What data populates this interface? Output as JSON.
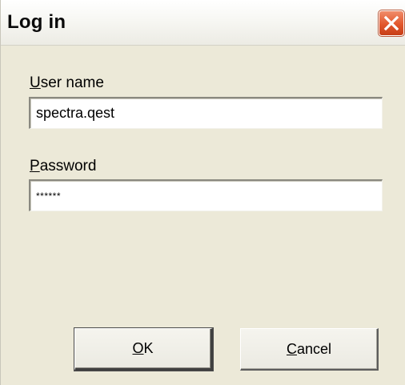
{
  "window": {
    "title": "Log in",
    "close_icon": "close-icon",
    "close_color": "#e2572c"
  },
  "form": {
    "username": {
      "label_accel": "U",
      "label_rest": "ser name",
      "value": "spectra.qest"
    },
    "password": {
      "label_accel": "P",
      "label_rest": "assword",
      "value": "******"
    }
  },
  "buttons": {
    "ok": {
      "accel": "O",
      "rest": "K"
    },
    "cancel": {
      "accel": "C",
      "rest": "ancel"
    }
  }
}
